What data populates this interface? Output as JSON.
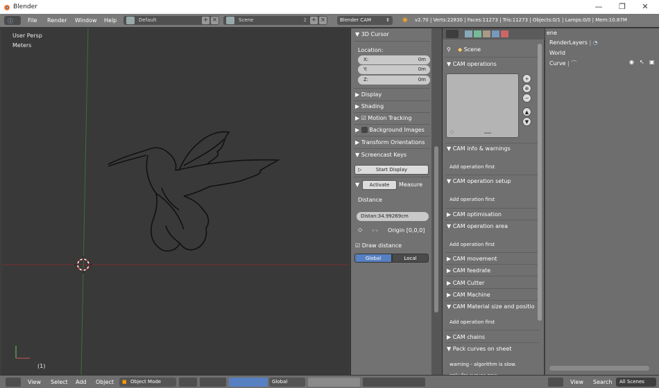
{
  "window": {
    "title": "Blender"
  },
  "menu": {
    "items": [
      "File",
      "Render",
      "Window",
      "Help"
    ]
  },
  "header": {
    "layout": "Default",
    "scene": "Scene",
    "scene_num": "2",
    "engine": "Blender CAM",
    "stats": "v2.70 | Verts:22830 | Faces:11273 | Tris:11273 | Objects:0/1 | Lamps:0/0 | Mem:10.87M"
  },
  "viewport": {
    "view_label": "User Persp",
    "units_label": "Meters",
    "frame": "(1)"
  },
  "sidebar": {
    "cursor_header": "3D Cursor",
    "location_label": "Location:",
    "coords": [
      {
        "axis": "X:",
        "value": "0m"
      },
      {
        "axis": "Y:",
        "value": "0m"
      },
      {
        "axis": "Z:",
        "value": "0m"
      }
    ],
    "panels": [
      "Display",
      "Shading",
      "Motion Tracking",
      "Background Images",
      "Transform Orientations",
      "Screencast Keys"
    ],
    "start_display": "Start Display",
    "activate": "Activate",
    "measure": "Measure",
    "distance_label": "Distance",
    "distance_value": "Distan:34.99269cm",
    "origin": "Origin [0,0,0]",
    "draw_distance": "Draw distance",
    "global": "Global",
    "local": "Local"
  },
  "properties": {
    "scene": "Scene",
    "panels": {
      "operations": "CAM operations",
      "info": "CAM info & warnings",
      "info_sub": "Add operation first",
      "setup": "CAM operation setup",
      "setup_sub": "Add operation first",
      "optim": "CAM optimisation",
      "area": "CAM operation area",
      "area_sub": "Add operation first",
      "movement": "CAM movement",
      "feedrate": "CAM feedrate",
      "cutter": "CAM Cutter",
      "machine": "CAM Machine",
      "material": "CAM Material size and positio",
      "material_sub": "Add operation first",
      "chains": "CAM chains",
      "pack": "Pack curves on sheet",
      "pack_sub1": "warning - algorithm is slow.",
      "pack_sub2": "only for curves now."
    }
  },
  "outliner": {
    "partial": "ene",
    "render_layers": "RenderLayers",
    "world": "World",
    "curve": "Curve"
  },
  "bottom": {
    "view": "View",
    "select": "Select",
    "add": "Add",
    "object": "Object",
    "mode": "Object Mode",
    "orientation": "Global"
  },
  "outliner_bottom": {
    "view": "View",
    "search": "Search",
    "scenes": "All Scenes"
  }
}
